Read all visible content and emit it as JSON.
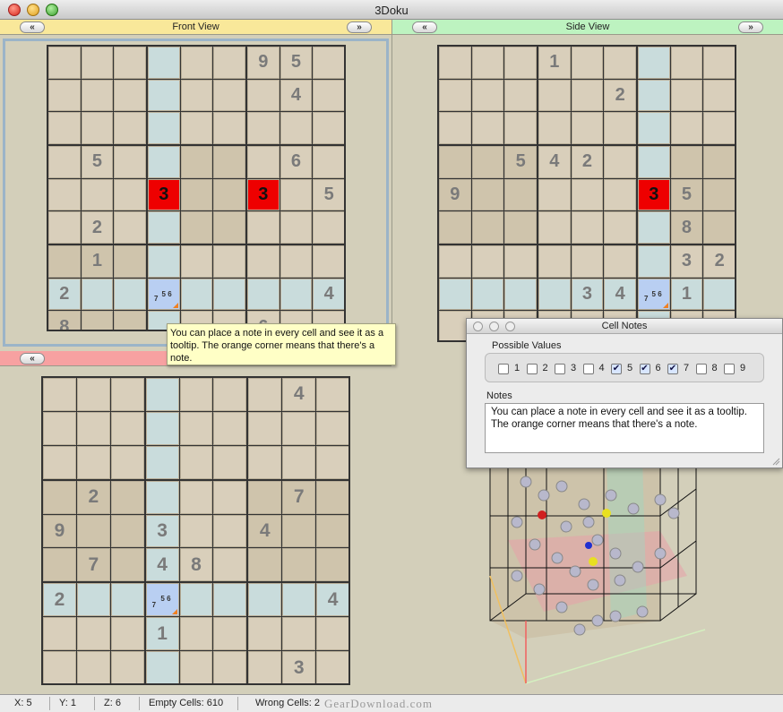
{
  "window": {
    "title": "3Doku"
  },
  "panes": {
    "front": {
      "label": "Front View",
      "prev": "«",
      "next": "»"
    },
    "side": {
      "label": "Side View",
      "prev": "«",
      "next": "»"
    },
    "top": {
      "label": "",
      "prev": "«",
      "next": "»"
    }
  },
  "colors": {
    "cell_tan": "#d9cfbb",
    "cell_dark": "#cfc4ac",
    "cell_blue": "#c9dcdc",
    "highlight_red": "#ee0000",
    "selected_blue": "#b9cff2",
    "note_orange": "#f08020"
  },
  "grids": {
    "front": {
      "values": [
        [
          "",
          "",
          "",
          "",
          "",
          "",
          "9",
          "5",
          ""
        ],
        [
          "",
          "",
          "",
          "",
          "",
          "",
          "",
          "4",
          ""
        ],
        [
          "",
          "",
          "",
          "",
          "",
          "",
          "",
          "",
          ""
        ],
        [
          "",
          "5",
          "",
          "",
          "",
          "",
          "",
          "6",
          ""
        ],
        [
          "",
          "",
          "",
          "3",
          "",
          "",
          "3",
          "",
          "5"
        ],
        [
          "",
          "2",
          "",
          "",
          "",
          "",
          "",
          "",
          ""
        ],
        [
          "",
          "1",
          "",
          "",
          "",
          "",
          "",
          "",
          ""
        ],
        [
          "2",
          "",
          "",
          "",
          "",
          "",
          "",
          "",
          "4"
        ],
        [
          "8",
          "",
          "",
          "",
          "",
          "",
          "6",
          "",
          ""
        ]
      ],
      "note_cell": {
        "row": 7,
        "col": 3,
        "top": "5 6",
        "bottom": "7"
      }
    },
    "side": {
      "values": [
        [
          "",
          "",
          "",
          "1",
          "",
          "",
          "",
          "",
          ""
        ],
        [
          "",
          "",
          "",
          "",
          "",
          "2",
          "",
          "",
          ""
        ],
        [
          "",
          "",
          "",
          "",
          "",
          "",
          "",
          "",
          ""
        ],
        [
          "",
          "",
          "5",
          "4",
          "2",
          "",
          "",
          "",
          ""
        ],
        [
          "9",
          "",
          "",
          "",
          "",
          "",
          "3",
          "5",
          ""
        ],
        [
          "",
          "",
          "",
          "",
          "",
          "",
          "",
          "8",
          ""
        ],
        [
          "",
          "",
          "",
          "",
          "",
          "",
          "",
          "3",
          "2"
        ],
        [
          "",
          "",
          "",
          "",
          "3",
          "4",
          "",
          "1",
          ""
        ],
        [
          "",
          "",
          "",
          "",
          "",
          "",
          "",
          "",
          ""
        ]
      ],
      "note_cell": {
        "row": 7,
        "col": 6,
        "top": "5 6",
        "bottom": "7"
      }
    },
    "top": {
      "values": [
        [
          "",
          "",
          "",
          "",
          "",
          "",
          "",
          "4",
          ""
        ],
        [
          "",
          "",
          "",
          "",
          "",
          "",
          "",
          "",
          ""
        ],
        [
          "",
          "",
          "",
          "",
          "",
          "",
          "",
          "",
          ""
        ],
        [
          "",
          "2",
          "",
          "",
          "",
          "",
          "",
          "7",
          ""
        ],
        [
          "9",
          "",
          "",
          "3",
          "",
          "",
          "4",
          "",
          ""
        ],
        [
          "",
          "7",
          "",
          "4",
          "8",
          "",
          "",
          "",
          ""
        ],
        [
          "2",
          "",
          "",
          "",
          "",
          "",
          "",
          "",
          "4"
        ],
        [
          "",
          "",
          "",
          "1",
          "",
          "",
          "",
          "",
          ""
        ],
        [
          "",
          "",
          "",
          "",
          "",
          "",
          "",
          "3",
          ""
        ]
      ],
      "note_cell": {
        "row": 6,
        "col": 3,
        "top": "5 6",
        "bottom": "7"
      }
    }
  },
  "tooltip": {
    "text": "You can place a note in every cell and see it as a tooltip. The orange corner means that there's a note."
  },
  "cell_notes": {
    "title": "Cell Notes",
    "possible_label": "Possible Values",
    "options": [
      {
        "label": "1",
        "checked": false
      },
      {
        "label": "2",
        "checked": false
      },
      {
        "label": "3",
        "checked": false
      },
      {
        "label": "4",
        "checked": false
      },
      {
        "label": "5",
        "checked": true
      },
      {
        "label": "6",
        "checked": true
      },
      {
        "label": "7",
        "checked": true
      },
      {
        "label": "8",
        "checked": false
      },
      {
        "label": "9",
        "checked": false
      }
    ],
    "notes_label": "Notes",
    "notes_text": "You can place a note in every cell and see it as a tooltip. The orange corner means that there's a note."
  },
  "status": {
    "x": "X: 5",
    "y": "Y: 1",
    "z": "Z: 6",
    "empty": "Empty Cells: 610",
    "wrong": "Wrong Cells: 2"
  },
  "watermark": "GearDownload.com"
}
